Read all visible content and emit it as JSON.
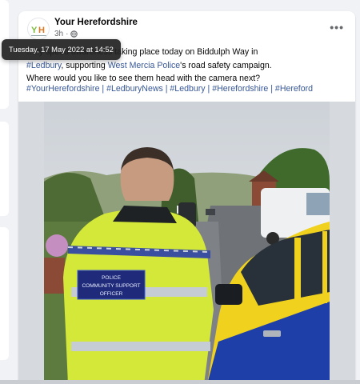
{
  "post": {
    "page_name": "Your Herefordshire",
    "age": "3h",
    "audience_icon": "globe-icon",
    "more_icon": "more-options-icon",
    "avatar_text": "YH",
    "text_line1_start": "…ity speed awareness taking place today on Biddulph Way in",
    "text_link_ledbury": "#Ledbury",
    "text_line2_mid": ", supporting ",
    "text_link_police": "West Mercia Police",
    "text_line2_end": "'s road safety campaign.",
    "text_line3": "Where would you like to see them head with the camera next?",
    "hashtags": "#YourHerefordshire | #LedburyNews | #Ledbury | #Herefordshire | #Hereford",
    "link_color": "#385898"
  },
  "tooltip": {
    "text": "Tuesday, 17 May 2022 at 14:52"
  },
  "photo": {
    "vest_text": "POLICE COMMUNITY SUPPORT OFFICER",
    "vest_line1": "POLICE",
    "vest_line2": "COMMUNITY SUPPORT",
    "vest_line3": "OFFICER"
  },
  "colors": {
    "hiviz": "#d4e83a",
    "police_blue": "#1f3fa8",
    "car_yellow": "#f2d21c"
  }
}
